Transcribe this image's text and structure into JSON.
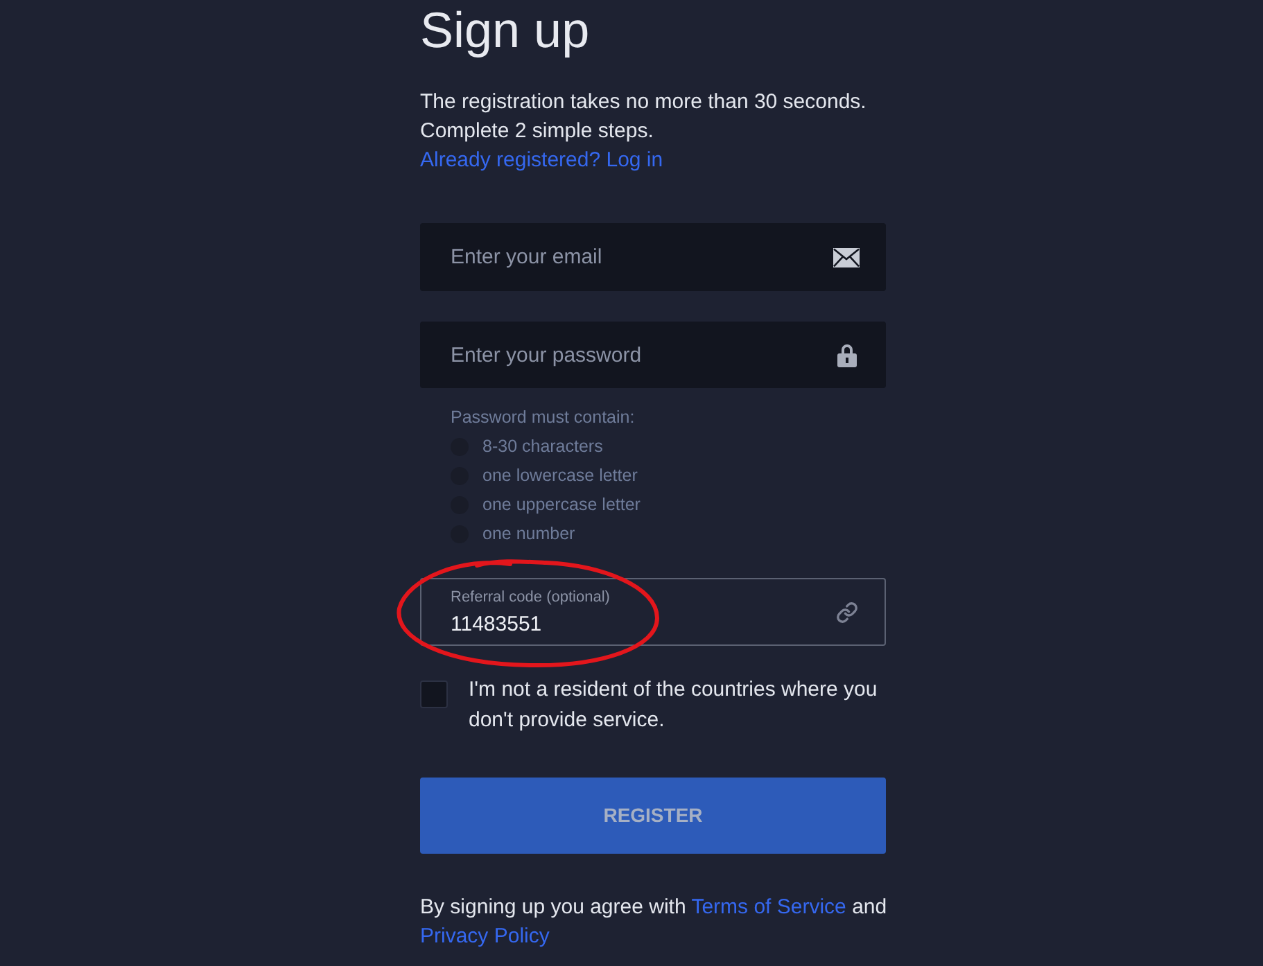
{
  "title": "Sign up",
  "intro": {
    "lines": [
      "The registration takes no more than 30 seconds.",
      "Complete 2 simple steps."
    ],
    "login_link": "Already registered? Log in"
  },
  "fields": [
    {
      "kind": "email",
      "placeholder": "Enter your email"
    },
    {
      "kind": "password",
      "placeholder": "Enter your password"
    }
  ],
  "password_rules": {
    "heading": "Password must contain:",
    "items": [
      {
        "label": "8-30 characters",
        "checked": false
      },
      {
        "label": "one lowercase letter",
        "checked": false
      },
      {
        "label": "one uppercase letter",
        "checked": false
      },
      {
        "label": "one number",
        "checked": false
      }
    ]
  },
  "referral": {
    "label": "Referral code (optional)",
    "value": "11483551",
    "circled": true
  },
  "residency": {
    "label": "I'm not a resident of the countries where you don't provide service.",
    "checked": false
  },
  "register_button": {
    "label": "REGISTER",
    "disabled": true
  },
  "footer": {
    "text": "By signing up you agree with",
    "terms_link": "Terms of Service",
    "conjunction": "and",
    "privacy_link": "Privacy Policy"
  }
}
